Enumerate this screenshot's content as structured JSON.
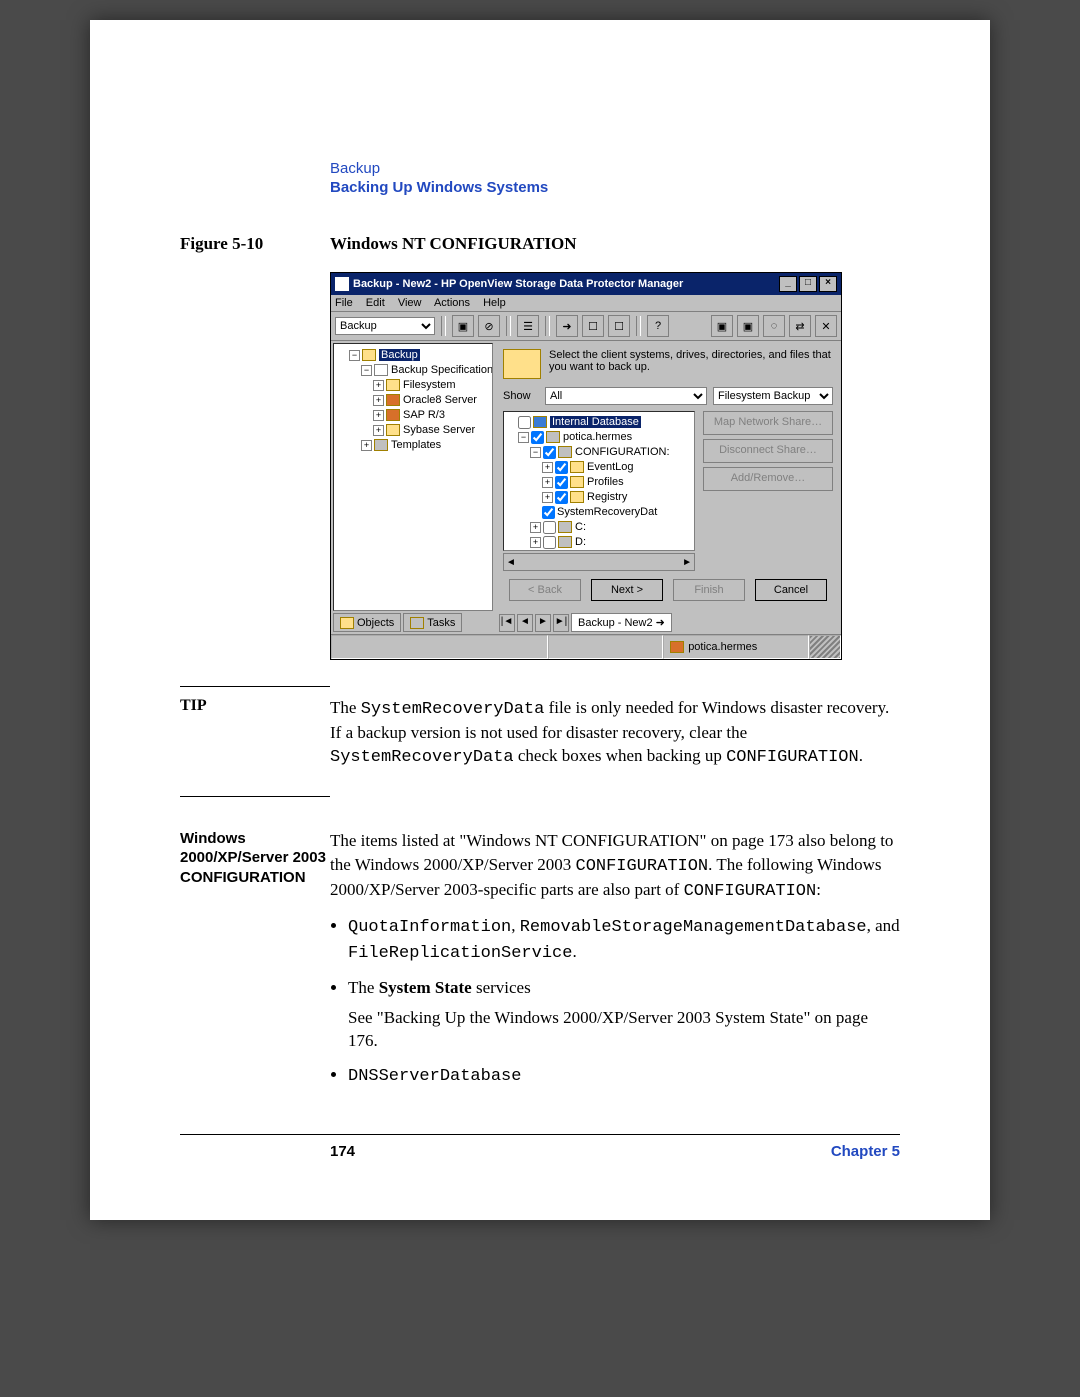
{
  "header": {
    "line1": "Backup",
    "line2": "Backing Up Windows Systems"
  },
  "figure": {
    "label": "Figure 5-10",
    "title": "Windows NT CONFIGURATION"
  },
  "win": {
    "title": "Backup - New2 - HP OpenView Storage Data Protector Manager",
    "menus": [
      "File",
      "Edit",
      "View",
      "Actions",
      "Help"
    ],
    "context_select": "Backup",
    "left_tree": {
      "root": "Backup",
      "spec": "Backup Specifications",
      "children": [
        "Filesystem",
        "Oracle8 Server",
        "SAP R/3",
        "Sybase Server"
      ],
      "templates": "Templates"
    },
    "right": {
      "instruction": "Select the client systems, drives, directories, and files that you want to back up.",
      "show_label": "Show",
      "show_value": "All",
      "backup_type": "Filesystem Backup",
      "tree": {
        "root": "Internal Database",
        "host": "potica.hermes",
        "config": "CONFIGURATION:",
        "items": [
          "EventLog",
          "Profiles",
          "Registry",
          "SystemRecoveryDat"
        ],
        "drives": [
          "C:",
          "D:"
        ]
      },
      "side_buttons": [
        "Map Network Share…",
        "Disconnect Share…",
        "Add/Remove…"
      ],
      "wizard": {
        "back": "< Back",
        "next": "Next >",
        "finish": "Finish",
        "cancel": "Cancel"
      }
    },
    "bottom_tabs_left": [
      "Objects",
      "Tasks"
    ],
    "bottom_tab_right": "Backup - New2",
    "status_host": "potica.hermes"
  },
  "tip": {
    "label": "TIP",
    "p1a": "The ",
    "p1b": "SystemRecoveryData",
    "p1c": " file is only needed for Windows disaster recovery. If a backup version is not used for disaster recovery, clear the ",
    "p1d": "SystemRecoveryData",
    "p1e": " check boxes when backing up ",
    "p1f": "CONFIGURATION",
    "p1g": "."
  },
  "section": {
    "label": "Windows 2000/XP/Server 2003 CONFIGURATION",
    "intro_a": "The items listed at \"Windows NT CONFIGURATION\" on page 173 also belong to the Windows 2000/XP/Server 2003 ",
    "intro_b": "CONFIGURATION",
    "intro_c": ". The following Windows 2000/XP/Server 2003-specific parts are also part of ",
    "intro_d": "CONFIGURATION",
    "intro_e": ":",
    "b1a": "QuotaInformation",
    "b1b": ", ",
    "b1c": "RemovableStorageManagementDatabase",
    "b1d": ", and ",
    "b1e": "FileReplicationService",
    "b1f": ".",
    "b2a": "The ",
    "b2b": "System State",
    "b2c": " services",
    "b2d": "See \"Backing Up the Windows 2000/XP/Server 2003 System State\" on page 176.",
    "b3": "DNSServerDatabase"
  },
  "footer": {
    "page": "174",
    "chapter": "Chapter 5"
  }
}
